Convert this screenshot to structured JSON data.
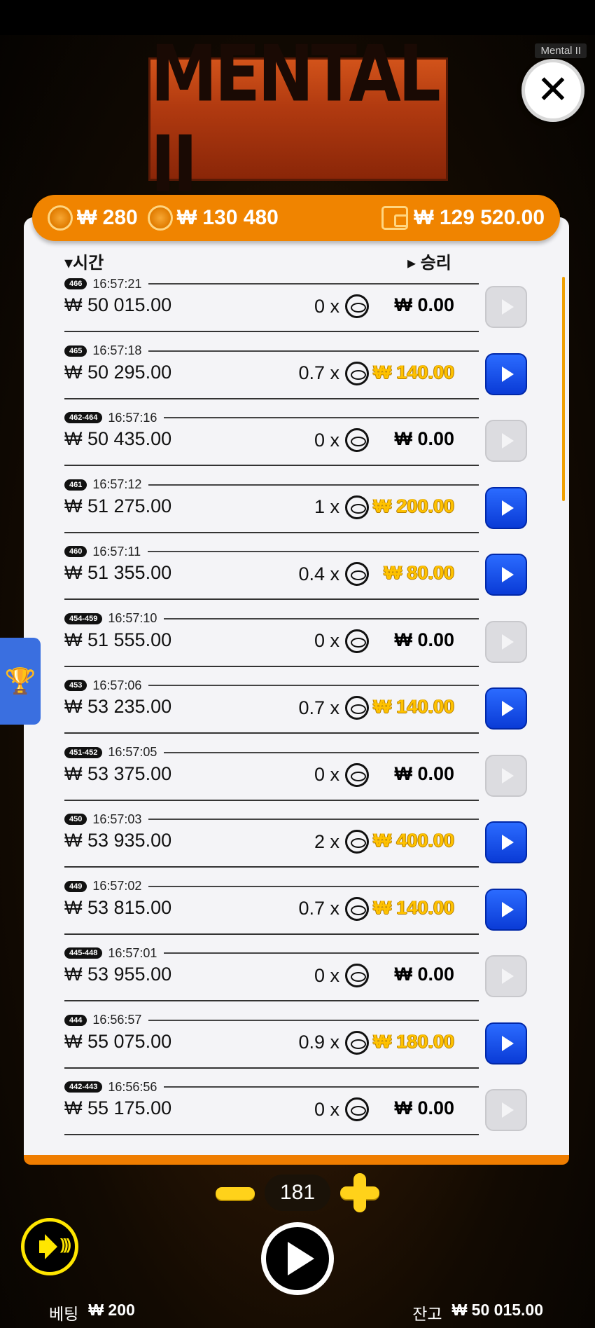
{
  "app": {
    "tag": "Mental II",
    "logo_text": "MENTAL II"
  },
  "header": {
    "coins_label": "₩ 280",
    "total_label": "₩ 130 480",
    "wallet_label": "₩ 129 520.00"
  },
  "columns": {
    "time": "▾시간",
    "win": "▸ 승리"
  },
  "rows": [
    {
      "id": "466",
      "time": "16:57:21",
      "amount": "₩ 50 015.00",
      "mult": "0 x",
      "win": "₩ 0.00",
      "active": false
    },
    {
      "id": "465",
      "time": "16:57:18",
      "amount": "₩ 50 295.00",
      "mult": "0.7 x",
      "win": "₩ 140.00",
      "active": true
    },
    {
      "id": "462-464",
      "time": "16:57:16",
      "amount": "₩ 50 435.00",
      "mult": "0 x",
      "win": "₩ 0.00",
      "active": false
    },
    {
      "id": "461",
      "time": "16:57:12",
      "amount": "₩ 51 275.00",
      "mult": "1 x",
      "win": "₩ 200.00",
      "active": true
    },
    {
      "id": "460",
      "time": "16:57:11",
      "amount": "₩ 51 355.00",
      "mult": "0.4 x",
      "win": "₩ 80.00",
      "active": true
    },
    {
      "id": "454-459",
      "time": "16:57:10",
      "amount": "₩ 51 555.00",
      "mult": "0 x",
      "win": "₩ 0.00",
      "active": false
    },
    {
      "id": "453",
      "time": "16:57:06",
      "amount": "₩ 53 235.00",
      "mult": "0.7 x",
      "win": "₩ 140.00",
      "active": true
    },
    {
      "id": "451-452",
      "time": "16:57:05",
      "amount": "₩ 53 375.00",
      "mult": "0 x",
      "win": "₩ 0.00",
      "active": false
    },
    {
      "id": "450",
      "time": "16:57:03",
      "amount": "₩ 53 935.00",
      "mult": "2 x",
      "win": "₩ 400.00",
      "active": true
    },
    {
      "id": "449",
      "time": "16:57:02",
      "amount": "₩ 53 815.00",
      "mult": "0.7 x",
      "win": "₩ 140.00",
      "active": true
    },
    {
      "id": "445-448",
      "time": "16:57:01",
      "amount": "₩ 53 955.00",
      "mult": "0 x",
      "win": "₩ 0.00",
      "active": false
    },
    {
      "id": "444",
      "time": "16:56:57",
      "amount": "₩ 55 075.00",
      "mult": "0.9 x",
      "win": "₩ 180.00",
      "active": true
    },
    {
      "id": "442-443",
      "time": "16:56:56",
      "amount": "₩ 55 175.00",
      "mult": "0 x",
      "win": "₩ 0.00",
      "active": false
    }
  ],
  "controls": {
    "count": "181",
    "bet_label": "베팅",
    "bet_value": "₩ 200",
    "balance_label": "잔고",
    "balance_value": "₩ 50 015.00"
  },
  "colors": {
    "accent": "#f08400",
    "play_active": "#0a3bd6",
    "win_gold": "#ffc200",
    "control_yellow": "#ffd21a"
  },
  "icons": {
    "close": "close-icon",
    "trophy": "trophy-icon",
    "sound": "speaker-icon",
    "play": "play-icon",
    "coin": "coin-icon",
    "wallet": "wallet-icon"
  }
}
